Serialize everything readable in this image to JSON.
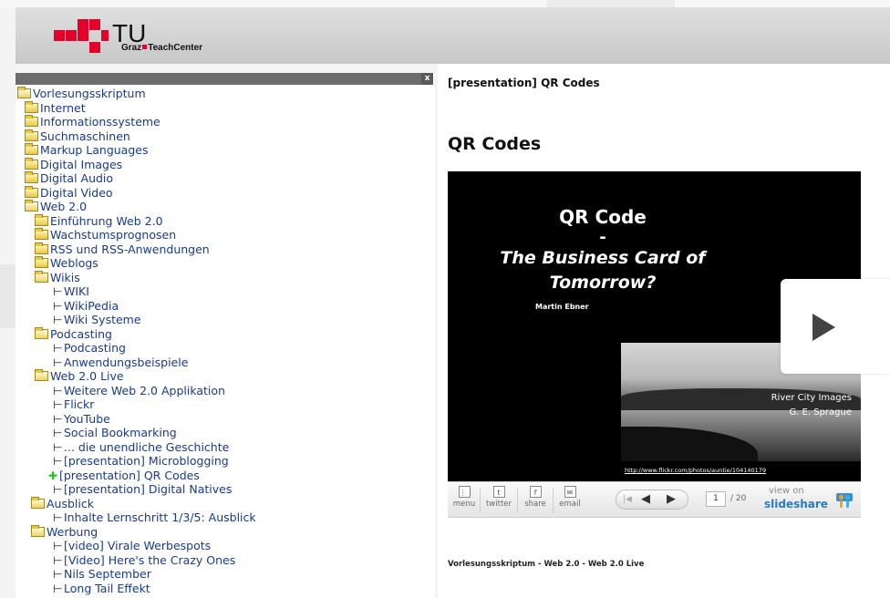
{
  "header": {
    "logo_main": "TU",
    "logo_sub_left": "Graz",
    "logo_sub_right": "TeachCenter",
    "brand_color": "#e4002b"
  },
  "sidebar": {
    "close_label": "x",
    "tree": [
      {
        "label": "Vorlesungsskriptum",
        "kind": "folder-open"
      },
      {
        "label": "Internet",
        "kind": "folder"
      },
      {
        "label": "Informationssysteme",
        "kind": "folder"
      },
      {
        "label": "Suchmaschinen",
        "kind": "folder"
      },
      {
        "label": "Markup Languages",
        "kind": "folder"
      },
      {
        "label": "Digital Images",
        "kind": "folder"
      },
      {
        "label": "Digital Audio",
        "kind": "folder"
      },
      {
        "label": "Digital Video",
        "kind": "folder"
      },
      {
        "label": "Web 2.0",
        "kind": "folder-open"
      },
      {
        "label": "Einführung Web 2.0",
        "kind": "folder"
      },
      {
        "label": "Wachstumsprognosen",
        "kind": "folder"
      },
      {
        "label": "RSS und RSS-Anwendungen",
        "kind": "folder"
      },
      {
        "label": "Weblogs",
        "kind": "folder"
      },
      {
        "label": "Wikis",
        "kind": "folder-open"
      },
      {
        "label": "WIKI",
        "kind": "page"
      },
      {
        "label": "WikiPedia",
        "kind": "page"
      },
      {
        "label": "Wiki Systeme",
        "kind": "page"
      },
      {
        "label": "Podcasting",
        "kind": "folder-open"
      },
      {
        "label": "Podcasting",
        "kind": "page"
      },
      {
        "label": "Anwendungsbeispiele",
        "kind": "page"
      },
      {
        "label": "Web 2.0 Live",
        "kind": "folder-open"
      },
      {
        "label": "Weitere Web 2.0 Applikation",
        "kind": "page"
      },
      {
        "label": "Flickr",
        "kind": "page"
      },
      {
        "label": "YouTube",
        "kind": "page"
      },
      {
        "label": "Social Bookmarking",
        "kind": "page"
      },
      {
        "label": "... die unendliche Geschichte",
        "kind": "page"
      },
      {
        "label": "[presentation] Microblogging",
        "kind": "page"
      },
      {
        "label": "[presentation] QR Codes",
        "kind": "current"
      },
      {
        "label": "[presentation] Digital Natives",
        "kind": "page"
      },
      {
        "label": "Ausblick",
        "kind": "folder-open"
      },
      {
        "label": "Inhalte Lernschritt 1/3/5: Ausblick",
        "kind": "page"
      },
      {
        "label": "Werbung",
        "kind": "folder-open"
      },
      {
        "label": "[video] Virale Werbespots",
        "kind": "page"
      },
      {
        "label": "[Video] Here's the Crazy Ones",
        "kind": "page"
      },
      {
        "label": "Nils September",
        "kind": "page"
      },
      {
        "label": "Long Tail Effekt",
        "kind": "page"
      }
    ],
    "current_marker_color": "#22c322"
  },
  "main": {
    "crumb_title": "[presentation] QR Codes",
    "title": "QR Codes",
    "slide": {
      "line1": "QR Code",
      "line2": "-",
      "line3": "The Business Card of",
      "line4": "Tomorrow?",
      "author": "Martin Ebner",
      "photo_credit_1": "River City Images",
      "photo_credit_2": "G. E. Sprague",
      "link": "http://www.flickr.com/photos/auntie/104140179"
    },
    "toolbar": {
      "menu_label": "menu",
      "twitter_label": "twitter",
      "share_label": "share",
      "email_label": "email",
      "prev_symbol": "◀",
      "next_symbol": "▶",
      "first_symbol": "|◀",
      "page_current": "1",
      "page_total": "/ 20",
      "view_on": "view on",
      "brand": "slideshare",
      "brand_color": "#2a7cc2"
    },
    "footer_crumb": "Vorlesungsskriptum - Web 2.0 - Web 2.0 Live"
  }
}
